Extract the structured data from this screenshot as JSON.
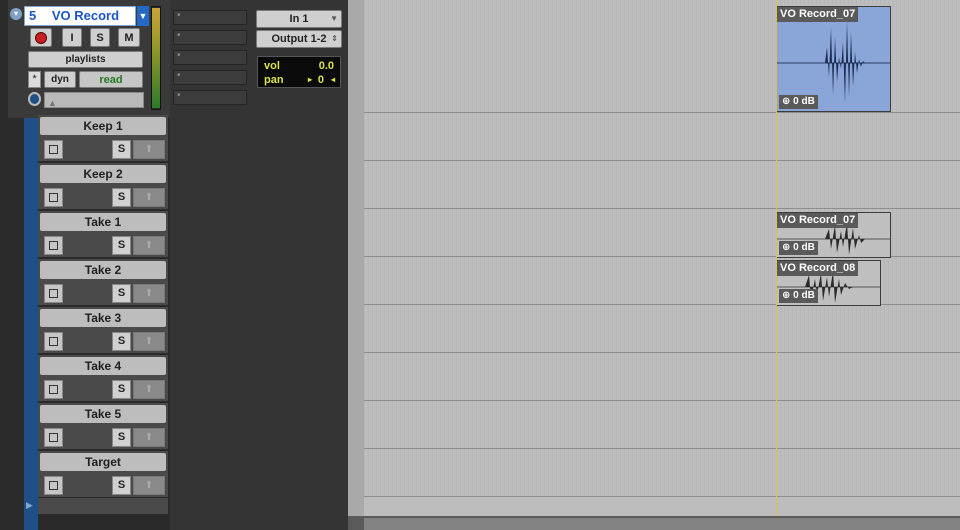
{
  "track": {
    "number": "5",
    "name": "VO Record",
    "rec_label": "",
    "input_label": "I",
    "solo_label": "S",
    "mute_label": "M",
    "playlists_label": "playlists",
    "auto_symbol": "*",
    "dyn_label": "dyn",
    "automation_mode": "read",
    "input": "In 1",
    "output": "Output 1-2",
    "vol_label": "vol",
    "vol_value": "0.0",
    "pan_label": "pan",
    "pan_value": "0"
  },
  "playlists": [
    {
      "name": "Keep 1"
    },
    {
      "name": "Keep 2"
    },
    {
      "name": "Take 1"
    },
    {
      "name": "Take 2"
    },
    {
      "name": "Take 3"
    },
    {
      "name": "Take 4"
    },
    {
      "name": "Take 5"
    },
    {
      "name": "Target"
    }
  ],
  "lane_solo_label": "S",
  "clips": {
    "main": {
      "name": "VO Record_07",
      "gain": "0 dB"
    },
    "take1": {
      "name": "VO Record_07",
      "gain": "0 dB"
    },
    "take2": {
      "name": "VO Record_08",
      "gain": "0 dB"
    }
  },
  "colors": {
    "selected_clip": "#8aa6d8",
    "track_accent": "#1f4f86",
    "automation_read": "#237a23",
    "meter_green": "#2f7a2a"
  }
}
